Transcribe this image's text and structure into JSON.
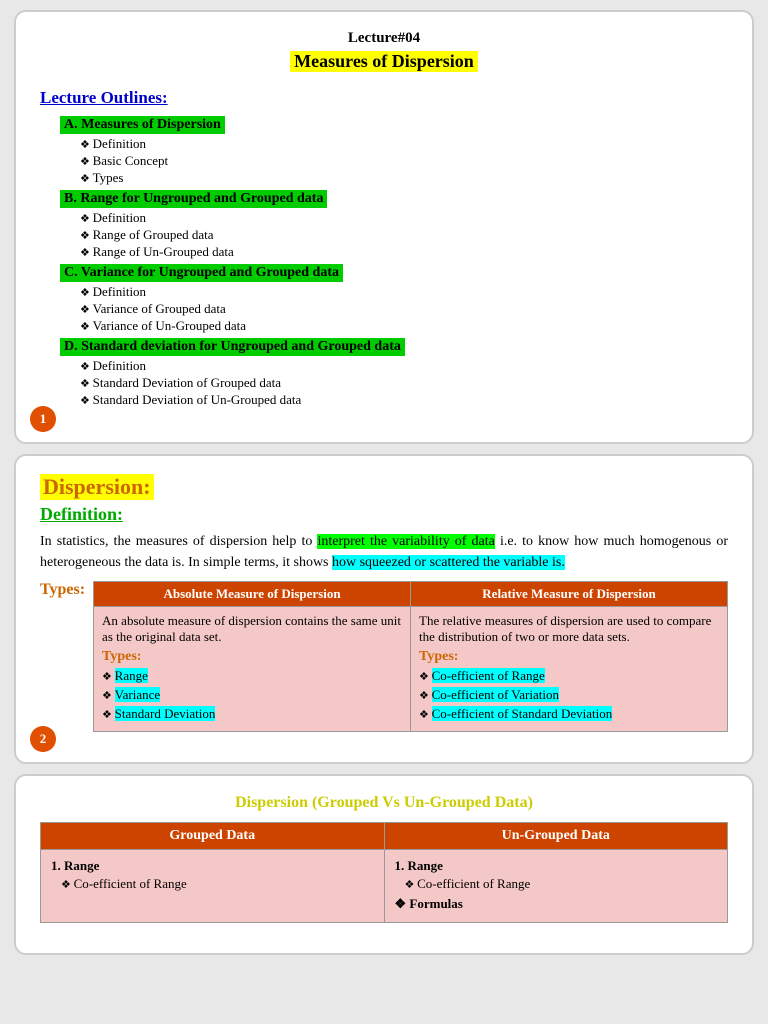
{
  "slide1": {
    "lecture_label": "Lecture#04",
    "title": "Measures of Dispersion",
    "outlines_heading": "Lecture Outlines:",
    "sections": [
      {
        "heading": "A. Measures of Dispersion",
        "items": [
          "Definition",
          "Basic Concept",
          "Types"
        ]
      },
      {
        "heading": "B. Range for Ungrouped and Grouped data",
        "items": [
          "Definition",
          "Range  of Grouped data",
          "Range of Un-Grouped data"
        ]
      },
      {
        "heading": "C. Variance for Ungrouped and Grouped data",
        "items": [
          "Definition",
          "Variance  of Grouped data",
          "Variance of Un-Grouped data"
        ]
      },
      {
        "heading": "D. Standard deviation for Ungrouped and Grouped data",
        "items": [
          "Definition",
          "Standard Deviation  of Grouped data",
          "Standard Deviation of Un-Grouped data"
        ]
      }
    ],
    "slide_number": "1"
  },
  "slide2": {
    "dispersion_label": "Dispersion:",
    "definition_label": "Definition:",
    "para_start": "In statistics, the measures of dispersion help to ",
    "para_highlight1": "interpret the variability of data",
    "para_mid1": " i.e. to know how much homogenous or heterogeneous the data is. In simple terms, it shows ",
    "para_highlight2": "how squeezed or scattered the variable is.",
    "types_label": "Types:",
    "table_col1_heading": "Absolute Measure of Dispersion",
    "table_col2_heading": "Relative Measure of Dispersion",
    "col1_text": "An absolute measure of dispersion contains the same unit as the original data set.",
    "col1_types_heading": "Types:",
    "col1_items": [
      "Range",
      "Variance",
      "Standard Deviation"
    ],
    "col2_text": "The relative measures of dispersion are used to compare the distribution of two or more data sets.",
    "col2_types_heading": "Types:",
    "col2_items": [
      "Co-efficient of Range",
      "Co-efficient of Variation",
      "Co-efficient of Standard Deviation"
    ],
    "slide_number": "2"
  },
  "slide3": {
    "title": "Dispersion (Grouped Vs Un-Grouped Data)",
    "col1_heading": "Grouped Data",
    "col2_heading": "Un-Grouped Data",
    "col1_item1_heading": "1.  Range",
    "col1_item1_sub": [
      "Co-efficient of Range"
    ],
    "col2_item1_heading": "1.  Range",
    "col2_item1_sub": [
      "Co-efficient of Range"
    ],
    "col2_item2_heading": "Formulas"
  }
}
